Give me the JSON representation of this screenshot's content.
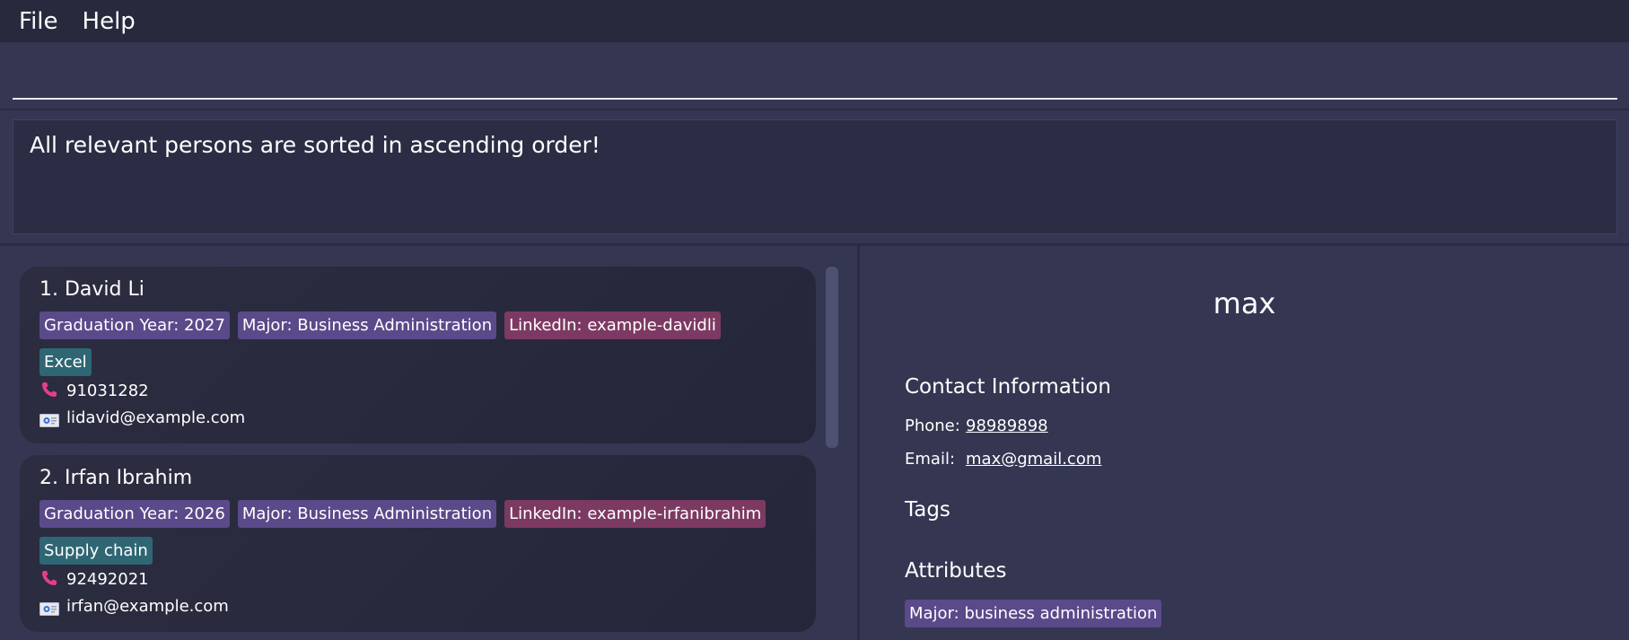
{
  "menu": {
    "items": [
      {
        "label": "File"
      },
      {
        "label": "Help"
      }
    ]
  },
  "command": {
    "value": "",
    "placeholder": ""
  },
  "result": {
    "message": "All relevant persons are sorted in ascending order!"
  },
  "persons": [
    {
      "index_name": "1. David Li",
      "tags": [
        {
          "label": "Graduation Year: 2027",
          "color": "purple"
        },
        {
          "label": "Major: Business Administration",
          "color": "purple"
        },
        {
          "label": "LinkedIn: example-davidli",
          "color": "pink"
        }
      ],
      "skills": [
        "Excel"
      ],
      "phone": "91031282",
      "email": "lidavid@example.com"
    },
    {
      "index_name": "2. Irfan Ibrahim",
      "tags": [
        {
          "label": "Graduation Year: 2026",
          "color": "purple"
        },
        {
          "label": "Major: Business Administration",
          "color": "purple"
        },
        {
          "label": "LinkedIn: example-irfanibrahim",
          "color": "pink"
        }
      ],
      "skills": [
        "Supply chain"
      ],
      "phone": "92492021",
      "email": "irfan@example.com"
    }
  ],
  "detail": {
    "name": "max",
    "contact_heading": "Contact Information",
    "phone_label": "Phone:",
    "phone_value": "98989898",
    "email_label": "Email:",
    "email_value": "max@gmail.com",
    "tags_heading": "Tags",
    "attributes_heading": "Attributes",
    "attributes": [
      "Major: business administration"
    ]
  },
  "colors": {
    "background": "#343652",
    "menubar": "#272a3d",
    "tag_purple": "#5a4a8a",
    "tag_pink": "#7c3a62",
    "tag_teal": "#2f6674",
    "phone_icon": "#e23f8a"
  },
  "icons": {
    "phone": "phone-icon",
    "email": "email-icon"
  }
}
